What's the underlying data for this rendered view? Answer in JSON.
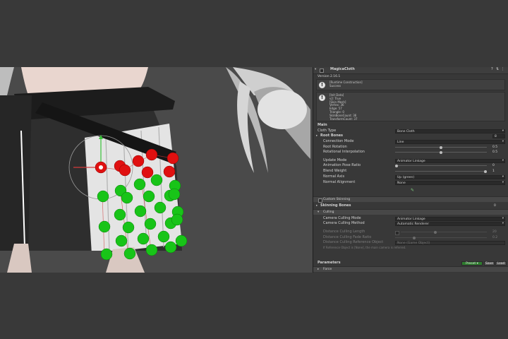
{
  "inspector": {
    "component_title": "MagicaCloth",
    "version": "Version 2.16.1",
    "status_box": {
      "lines": [
        "[Runtime Construction]",
        "Success"
      ]
    },
    "info_box": {
      "lines": [
        "[Init Data]",
        "v2: True",
        "[Skin Mesh]",
        "Vertex: 36",
        "Edge: 57",
        "Triangle: 0",
        "SkinBoneCount: 36",
        "TransformCount: 37"
      ]
    },
    "main_section": "Main",
    "cloth_type": {
      "label": "Cloth Type",
      "value": "Bone Cloth"
    },
    "root_bones": {
      "label": "Root Bones",
      "count": "8"
    },
    "connection_mode": {
      "label": "Connection Mode",
      "value": "Line"
    },
    "root_rotation": {
      "label": "Root Rotation",
      "value": "0.5",
      "fraction": 0.5
    },
    "rotational_interpolation": {
      "label": "Rotational Interpolation",
      "value": "0.5",
      "fraction": 0.5
    },
    "update_mode": {
      "label": "Update Mode",
      "value": "Animator Linkage"
    },
    "animation_pose_ratio": {
      "label": "Animation Pose Ratio",
      "value": "0",
      "fraction": 0.0
    },
    "blend_weight": {
      "label": "Blend Weight",
      "value": "1",
      "fraction": 1.0
    },
    "normal_axis": {
      "label": "Normal Axis",
      "value": "Up (green)"
    },
    "normal_alignment": {
      "label": "Normal Alignment",
      "value": "None"
    },
    "custom_skinning": "Custom Skinning",
    "skinning_bones": {
      "label": "Skinning Bones",
      "count": "0"
    },
    "culling": {
      "header": "Culling",
      "camera_culling_mode": {
        "label": "Camera Culling Mode",
        "value": "Animator Linkage"
      },
      "camera_culling_method": {
        "label": "Camera Culling Method",
        "value": "Automatic Renderer"
      },
      "distance_culling_length": {
        "label": "Distance Culling Length",
        "value": "20",
        "fraction": 0.4
      },
      "distance_culling_fade_ratio": {
        "label": "Distance Culling Fade Ratio",
        "value": "0.2",
        "fraction": 0.2
      },
      "distance_culling_reference_object": {
        "label": "Distance Culling Reference Object",
        "value": "None (Game Object)"
      },
      "note": "If Reference Object is [None], the main camera is referred."
    },
    "parameters": {
      "label": "Parameters",
      "preset": "Preset",
      "save": "Save",
      "load": "Load",
      "force": "Force"
    }
  }
}
